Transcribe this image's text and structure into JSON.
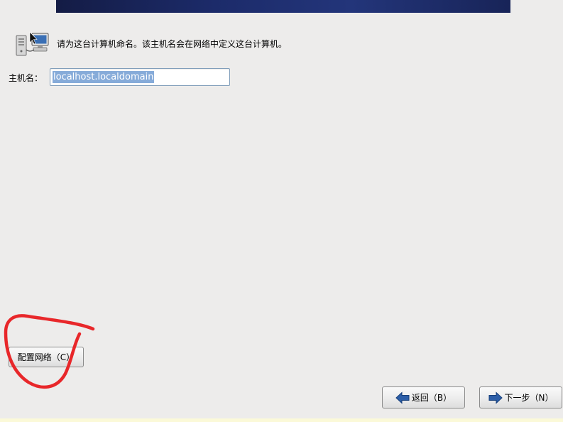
{
  "header": {
    "intro_text": "请为这台计算机命名。该主机名会在网络中定义这台计算机。",
    "icon": "network-computers-icon"
  },
  "hostname": {
    "label": "主机名：",
    "value": "localhost.localdomain"
  },
  "buttons": {
    "configure_network": "配置网络（C）",
    "back": "返回（B）",
    "next": "下一步（N）"
  },
  "icons": {
    "back": "arrow-left-icon",
    "next": "arrow-right-icon"
  },
  "colors": {
    "background": "#edeceb",
    "banner": "#1c2b6a",
    "selection": "#86abd9",
    "annotation": "#e8272a",
    "arrow": "#2c5ea8"
  }
}
